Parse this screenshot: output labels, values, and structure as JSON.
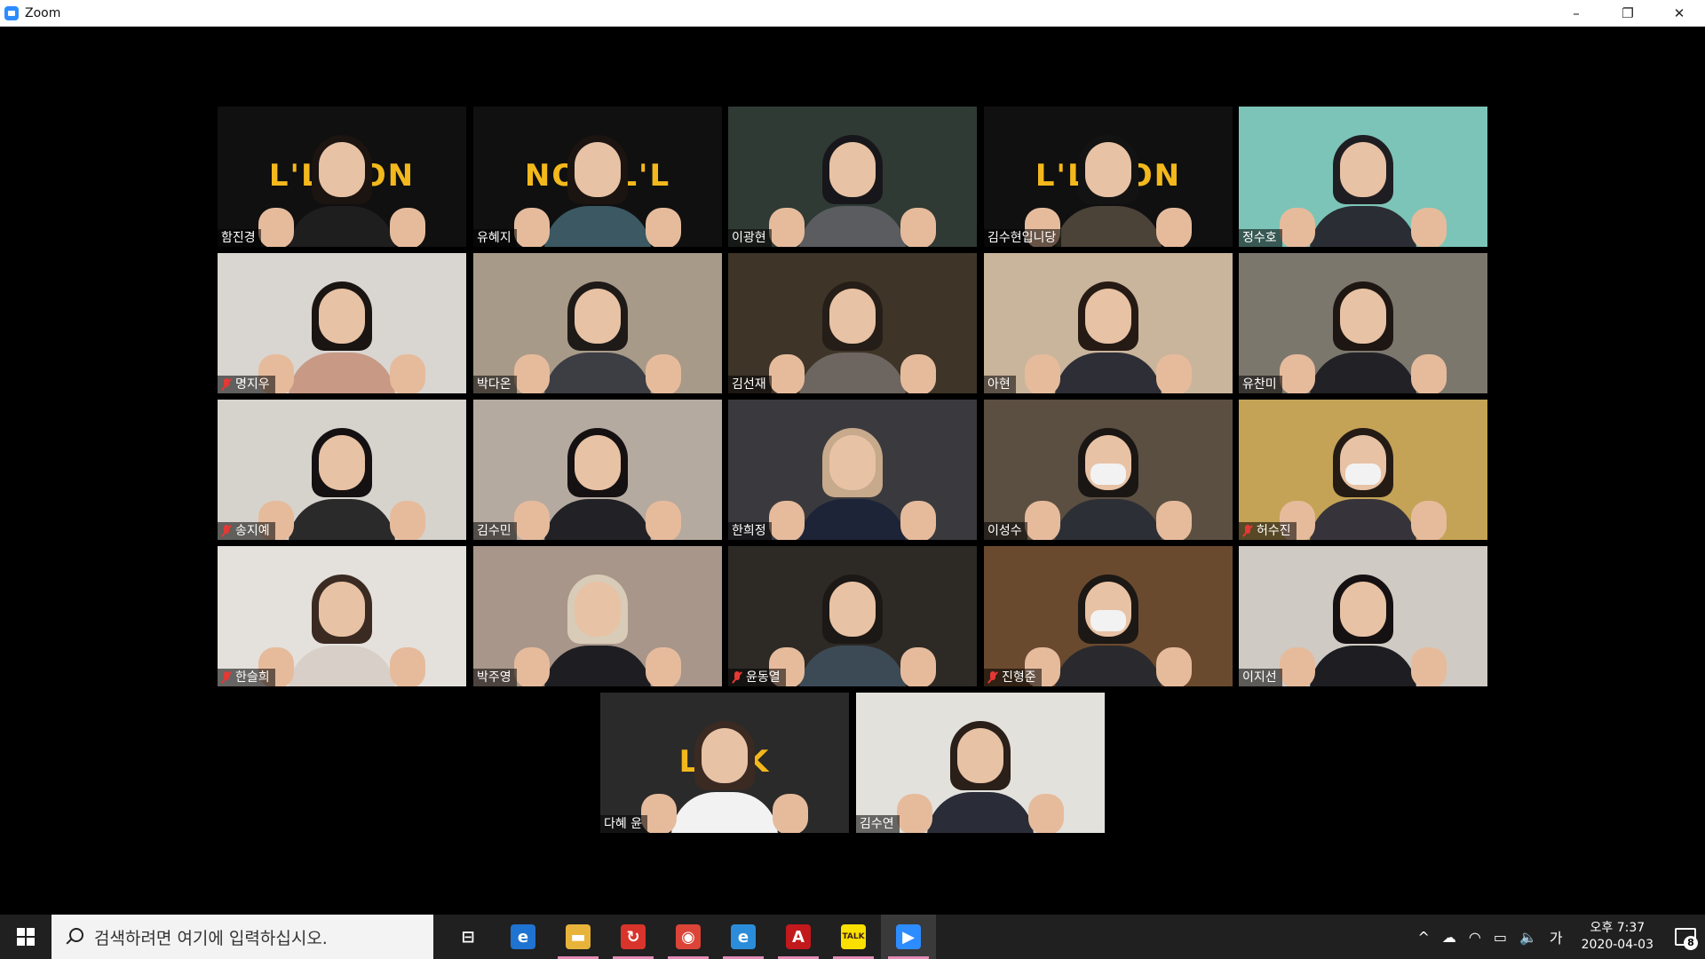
{
  "window": {
    "title": "Zoom",
    "minimize_glyph": "–",
    "restore_glyph": "❐",
    "close_glyph": "✕"
  },
  "participants": [
    {
      "name": "함진경",
      "muted": false,
      "banner": "L'LI  ION",
      "bg": "#101010",
      "hair": "#1b1411",
      "shirt": "#1e1e1e"
    },
    {
      "name": "유혜지",
      "muted": false,
      "banner": "NOI  IL'L",
      "bg": "#101010",
      "hair": "#1b1411",
      "shirt": "#3b5863"
    },
    {
      "name": "이광현",
      "muted": false,
      "banner": "",
      "bg": "#2f3a34",
      "hair": "#17171b",
      "shirt": "#5a5c60"
    },
    {
      "name": "김수현입니당",
      "muted": false,
      "banner": "L'LI  ION",
      "bg": "#101010",
      "hair": "#131313",
      "shirt": "#4b4238"
    },
    {
      "name": "정수호",
      "muted": false,
      "banner": "",
      "bg": "#7cc4b8",
      "hair": "#1e1e22",
      "shirt": "#2a2d33"
    },
    {
      "name": "명지우",
      "muted": true,
      "banner": "",
      "bg": "#d9d6d2",
      "hair": "#1a1412",
      "shirt": "#c89a85"
    },
    {
      "name": "박다온",
      "muted": false,
      "banner": "",
      "bg": "#a89a88",
      "hair": "#1e1a18",
      "shirt": "#3d3d44"
    },
    {
      "name": "김선재",
      "muted": false,
      "banner": "",
      "bg": "#3e3428",
      "hair": "#251d17",
      "shirt": "#6d655f"
    },
    {
      "name": "아현",
      "muted": false,
      "banner": "",
      "bg": "#c9b49c",
      "hair": "#261a14",
      "shirt": "#2e2e36"
    },
    {
      "name": "유찬미",
      "muted": false,
      "banner": "",
      "bg": "#7c776d",
      "hair": "#1d1612",
      "shirt": "#222226"
    },
    {
      "name": "송지예",
      "muted": true,
      "banner": "",
      "bg": "#d6d3cd",
      "hair": "#151112",
      "shirt": "#2a2a2a"
    },
    {
      "name": "김수민",
      "muted": false,
      "banner": "",
      "bg": "#b5aaa0",
      "hair": "#151112",
      "shirt": "#222226"
    },
    {
      "name": "한희정",
      "muted": false,
      "banner": "",
      "bg": "#3a3a3e",
      "hair": "#c7a98c",
      "shirt": "#1d2438"
    },
    {
      "name": "이성수",
      "muted": false,
      "banner": "",
      "bg": "#5b4f42",
      "hair": "#1a1614",
      "shirt": "#2d2f36",
      "mask": true,
      "active": true
    },
    {
      "name": "허수진",
      "muted": true,
      "banner": "",
      "bg": "#c4a356",
      "hair": "#251b15",
      "shirt": "#36343a",
      "mask": true
    },
    {
      "name": "한슬희",
      "muted": true,
      "banner": "",
      "bg": "#e4e1dc",
      "hair": "#3a2a22",
      "shirt": "#d8cfc8"
    },
    {
      "name": "박주영",
      "muted": false,
      "banner": "",
      "bg": "#a8968a",
      "hair": "#d8cbb8",
      "shirt": "#1e1e22"
    },
    {
      "name": "윤동열",
      "muted": true,
      "banner": "",
      "bg": "#2d2a26",
      "hair": "#1c1815",
      "shirt": "#3c4a55"
    },
    {
      "name": "진형준",
      "muted": true,
      "banner": "",
      "bg": "#6a4a2e",
      "hair": "#1c1815",
      "shirt": "#2a2a2e",
      "mask": true
    },
    {
      "name": "이지선",
      "muted": false,
      "banner": "",
      "bg": "#cfcac4",
      "hair": "#151112",
      "shirt": "#1e1e22"
    },
    {
      "name": "다혜 윤",
      "muted": false,
      "banner": "L'LIK",
      "bg": "#2a2a2a",
      "hair": "#3a2a22",
      "shirt": "#f2f2f2"
    },
    {
      "name": "김수연",
      "muted": false,
      "banner": "",
      "bg": "#e3e1dc",
      "hair": "#2a1f19",
      "shirt": "#2a2c38"
    }
  ],
  "taskbar": {
    "search_placeholder": "검색하려면 여기에 입력하십시오.",
    "apps": [
      {
        "name": "task-view-icon",
        "glyph": "⊟",
        "color": "#202020",
        "open": false
      },
      {
        "name": "edge-icon",
        "glyph": "e",
        "color": "#1f73d1",
        "open": false
      },
      {
        "name": "file-explorer-icon",
        "glyph": "▬",
        "color": "#e8b33a",
        "open": true
      },
      {
        "name": "sync-app-icon",
        "glyph": "↻",
        "color": "#d9342b",
        "open": true
      },
      {
        "name": "chrome-icon",
        "glyph": "◉",
        "color": "#db4437",
        "open": true
      },
      {
        "name": "ie-icon",
        "glyph": "e",
        "color": "#2b8dd9",
        "open": true
      },
      {
        "name": "acrobat-icon",
        "glyph": "A",
        "color": "#c1191c",
        "open": true
      },
      {
        "name": "kakaotalk-icon",
        "glyph": "TALK",
        "color": "#f9e000",
        "open": true
      },
      {
        "name": "zoom-icon",
        "glyph": "▶",
        "color": "#2d8cff",
        "open": true,
        "active": true
      }
    ],
    "tray": {
      "chevron": "^",
      "cloud": "☁",
      "wifi": "◠",
      "battery": "▭",
      "volume": "🔈",
      "ime": "가"
    },
    "clock_time": "오후 7:37",
    "clock_date": "2020-04-03",
    "notification_count": "8"
  }
}
